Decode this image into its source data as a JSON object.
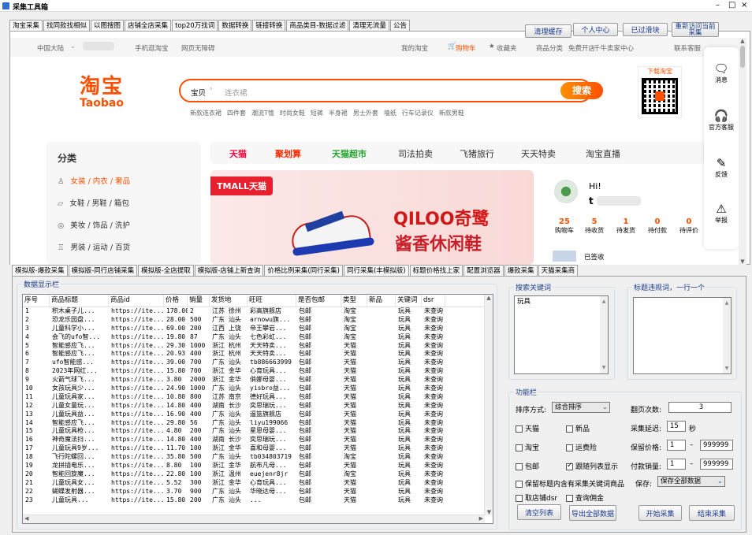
{
  "window": {
    "title": "采集工具箱",
    "controls": [
      "–",
      "□",
      "×"
    ]
  },
  "top_tabs": [
    "淘宝采集",
    "找同款找相似",
    "以图搜图",
    "店铺全店采集",
    "top20万找词",
    "数据转换",
    "链接转换",
    "商品类目-数据过滤",
    "清理无流量",
    "公告"
  ],
  "top_buttons": {
    "clear_cache": "清理缓存",
    "personal": "个人中心",
    "verified": "已过滑块",
    "reopen": "重新访问当前采集"
  },
  "taobao": {
    "topbar_left": [
      "中国大陆",
      "手机逛淘宝",
      "网页无障碍"
    ],
    "topbar_right": [
      "我的淘宝",
      "购物车",
      "收藏夹",
      "商品分类",
      "免费开店",
      "千牛卖家中心",
      "联系客服"
    ],
    "logo_cn": "淘宝",
    "logo_en": "Taobao",
    "search_scope": "宝贝",
    "search_placeholder": "连衣裙",
    "search_button": "搜索",
    "hot_words": [
      "新款连衣裙",
      "四件套",
      "潮流T恤",
      "时尚女鞋",
      "短裤",
      "半身裙",
      "男士外套",
      "墙纸",
      "行车记录仪",
      "新款男鞋"
    ],
    "qr_title": "下载淘宝",
    "category_title": "分类",
    "categories": [
      [
        "女装",
        "内衣",
        "奢品"
      ],
      [
        "女鞋",
        "男鞋",
        "箱包"
      ],
      [
        "美妆",
        "饰品",
        "洗护"
      ],
      [
        "男装",
        "运动",
        "百货"
      ]
    ],
    "nav": [
      "天猫",
      "聚划算",
      "天猫超市",
      "司法拍卖",
      "飞猪旅行",
      "天天特卖",
      "淘宝直播"
    ],
    "banner_tmall": "TMALL天猫",
    "banner_brand": "QILOO奇鹭",
    "banner_slogan": "酱香休闲鞋",
    "user_greet": "Hi!",
    "user_name": "t",
    "user_stats": [
      {
        "n": "25",
        "l": "购物车"
      },
      {
        "n": "5",
        "l": "待收货"
      },
      {
        "n": "1",
        "l": "待发货"
      },
      {
        "n": "0",
        "l": "待付款"
      },
      {
        "n": "0",
        "l": "待评价"
      }
    ],
    "signed": "已签收",
    "side": [
      {
        "icon": "message-icon",
        "l": "消息"
      },
      {
        "icon": "headset-icon",
        "l": "官方客服"
      },
      {
        "icon": "edit-icon",
        "l": "反馈"
      },
      {
        "icon": "warning-icon",
        "l": "举报"
      }
    ]
  },
  "sub_tabs": [
    "模拟版-爆款采集",
    "模拟版-同行店铺采集",
    "模拟版-全店提取",
    "模拟版-店铺上新查询",
    "价格比例采集(同行采集)",
    "同行采集(丰模拟版)",
    "标题价格找上家",
    "配置浏览器",
    "爆款采集",
    "天猫采集商"
  ],
  "data_panel": {
    "title": "数据显示栏",
    "columns": [
      "序号",
      "商品标题",
      "商品id",
      "价格",
      "销量",
      "发货地",
      "旺旺",
      "是否包邮",
      "类型",
      "新品",
      "关键词",
      "dsr"
    ],
    "rows": [
      [
        "1",
        "积木桌子儿...",
        "https://ite...",
        "178.00",
        "2",
        "江苏 徐州",
        "彩高旗舰店",
        "包邮",
        "淘宝",
        "",
        "玩具",
        "未查询"
      ],
      [
        "2",
        "恐龙乐园盘...",
        "https://ite...",
        "28.00",
        "500",
        "广东 汕头",
        "arnowu旗...",
        "包邮",
        "淘宝",
        "",
        "玩具",
        "未查询"
      ],
      [
        "3",
        "儿童科学小...",
        "https://ite...",
        "69.00",
        "200",
        "江西 上饶",
        "帝王攀岩...",
        "包邮",
        "淘宝",
        "",
        "玩具",
        "未查询"
      ],
      [
        "4",
        "会飞的ufo智...",
        "https://ite...",
        "19.80",
        "87",
        "广东 汕头",
        "七色彩虹...",
        "包邮",
        "淘宝",
        "",
        "玩具",
        "未查询"
      ],
      [
        "5",
        "智能感应飞...",
        "https://ite...",
        "29.30",
        "1000",
        "浙江 杭州",
        "天天特卖...",
        "包邮",
        "天猫",
        "",
        "玩具",
        "未查询"
      ],
      [
        "6",
        "智能感应飞...",
        "https://ite...",
        "20.93",
        "400",
        "浙江 杭州",
        "天天特卖...",
        "包邮",
        "天猫",
        "",
        "玩具",
        "未查询"
      ],
      [
        "7",
        "ufo智能感...",
        "https://ite...",
        "39.00",
        "700",
        "广东 汕头",
        "tb886663999",
        "包邮",
        "天猫",
        "",
        "玩具",
        "未查询"
      ],
      [
        "8",
        "2023年网红...",
        "https://ite...",
        "15.80",
        "700",
        "浙江 金华",
        "心育玩具...",
        "包邮",
        "天猫",
        "",
        "玩具",
        "未查询"
      ],
      [
        "9",
        "火箭气球飞...",
        "https://ite...",
        "3.80",
        "2000",
        "浙江 金华",
        "俏娜母婴...",
        "包邮",
        "天猫",
        "",
        "玩具",
        "未查询"
      ],
      [
        "10",
        "女孩玩具少...",
        "https://ite...",
        "24.90",
        "1000",
        "广东 汕头",
        "yisbro益...",
        "包邮",
        "天猫",
        "",
        "玩具",
        "未查询"
      ],
      [
        "11",
        "儿童玩具家...",
        "https://ite...",
        "10.80",
        "800",
        "江苏 南京",
        "德好玩具...",
        "包邮",
        "天猫",
        "",
        "玩具",
        "未查询"
      ],
      [
        "12",
        "儿童女童玩...",
        "https://ite...",
        "14.80",
        "400",
        "湖南 长沙",
        "奕思瑞玩...",
        "包邮",
        "天猫",
        "",
        "玩具",
        "未查询"
      ],
      [
        "13",
        "儿童玩具益...",
        "https://ite...",
        "16.90",
        "400",
        "广东 汕头",
        "遥篮旗舰店",
        "包邮",
        "天猫",
        "",
        "玩具",
        "未查询"
      ],
      [
        "14",
        "智能感应飞...",
        "https://ite...",
        "29.80",
        "56",
        "广东 汕头",
        "liyu199066",
        "包邮",
        "天猫",
        "",
        "玩具",
        "未查询"
      ],
      [
        "15",
        "儿童玩具枪...",
        "https://ite...",
        "4.80",
        "200",
        "广东 汕头",
        "星恩母婴...",
        "包邮",
        "天猫",
        "",
        "玩具",
        "未查询"
      ],
      [
        "16",
        "神奇魔法扫...",
        "https://ite...",
        "14.80",
        "400",
        "湖南 长沙",
        "奕思瑞玩...",
        "包邮",
        "天猫",
        "",
        "玩具",
        "未查询"
      ],
      [
        "17",
        "儿童玩具9岁...",
        "https://ite...",
        "11.70",
        "100",
        "浙江 金华",
        "喜和母婴...",
        "包邮",
        "天猫",
        "",
        "玩具",
        "未查询"
      ],
      [
        "18",
        "飞行陀螺回...",
        "https://ite...",
        "35.80",
        "500",
        "广东 汕头",
        "tb034803719",
        "包邮",
        "淘宝",
        "",
        "玩具",
        "未查询"
      ],
      [
        "19",
        "龙拼插电乐...",
        "https://ite...",
        "8.80",
        "100",
        "浙江 金华",
        "航布凡母...",
        "包邮",
        "天猫",
        "",
        "玩具",
        "未查询"
      ],
      [
        "20",
        "智能回旋魔...",
        "https://ite...",
        "22.80",
        "100",
        "浙江 温州",
        "euejenr8jr",
        "包邮",
        "淘宝",
        "",
        "玩具",
        "未查询"
      ],
      [
        "21",
        "儿童玩具女...",
        "https://ite...",
        "5.52",
        "300",
        "浙江 金华",
        "心育玩具...",
        "包邮",
        "天猫",
        "",
        "玩具",
        "未查询"
      ],
      [
        "22",
        "蝴蝶发射器...",
        "https://ite...",
        "3.70",
        "900",
        "广东 汕头",
        "华晓达母...",
        "包邮",
        "天猫",
        "",
        "玩具",
        "未查询"
      ],
      [
        "23",
        "儿童玩具...",
        "https://ite...",
        "15.80",
        "200",
        "广东 汕头",
        "...",
        "包邮",
        "天猫",
        "",
        "玩具",
        "未查询"
      ]
    ]
  },
  "keywords": {
    "title": "搜索关键词",
    "value": "玩具"
  },
  "filter_words": {
    "title": "标题违规词，一行一个",
    "value": ""
  },
  "func": {
    "title": "功能栏",
    "sort_label": "排序方式:",
    "sort_value": "综合排序",
    "pages_label": "翻页次数:",
    "pages_value": "3",
    "cb_tmall": "天猫",
    "cb_new": "新品",
    "delay_label": "采集延迟:",
    "delay_value": "15",
    "delay_unit": "秒",
    "cb_taobao": "淘宝",
    "cb_insurance": "运费险",
    "price_label": "保留价格:",
    "price_min": "1",
    "price_max": "999999",
    "cb_freeship": "包邮",
    "cb_follow": "跟随列表显示",
    "pay_label": "付款销量:",
    "pay_min": "1",
    "pay_max": "999999",
    "cb_keep_title": "保留标题内含有采集关键词商品",
    "save_label": "保存:",
    "save_value": "保存全部数据",
    "cb_dsr": "取店铺dsr",
    "cb_commission": "查询佣金",
    "btn_clear": "清空列表",
    "btn_export": "导出全部数据",
    "btn_start": "开始采集",
    "btn_stop": "结束采集"
  },
  "colors": {
    "taobao_orange": "#ff5000",
    "title_blue": "#1a3a8a"
  }
}
